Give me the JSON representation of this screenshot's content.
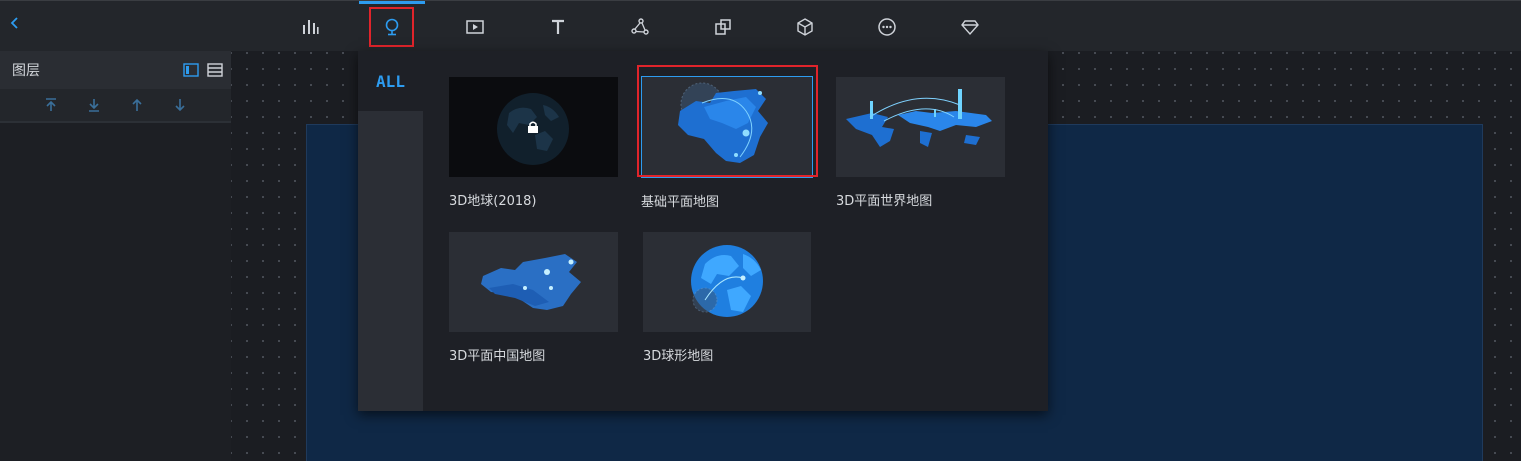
{
  "toolbar": {
    "back_icon": "chevron-left-icon",
    "tools": [
      {
        "name": "chart-bars-icon"
      },
      {
        "name": "map-pin-icon",
        "active": true
      },
      {
        "name": "media-icon"
      },
      {
        "name": "text-icon"
      },
      {
        "name": "network-icon"
      },
      {
        "name": "layers-icon"
      },
      {
        "name": "cube-icon"
      },
      {
        "name": "more-icon"
      },
      {
        "name": "diamond-icon"
      }
    ]
  },
  "layers_panel": {
    "title": "图层"
  },
  "dropdown": {
    "tab_label": "ALL",
    "items": [
      {
        "label": "3D地球(2018)",
        "locked": true
      },
      {
        "label": "基础平面地图",
        "selected": true
      },
      {
        "label": "3D平面世界地图"
      },
      {
        "label": "3D平面中国地图"
      },
      {
        "label": "3D球形地图"
      }
    ]
  },
  "colors": {
    "accent": "#2d9cf0",
    "highlight": "#e0242b",
    "screen_bg": "#0f2846"
  }
}
